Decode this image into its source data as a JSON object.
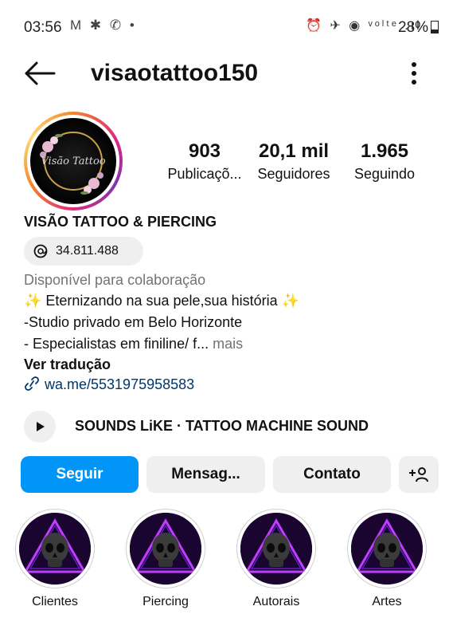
{
  "status_bar": {
    "time": "03:56",
    "left_icons": "M ✱ ✆ •",
    "right_icons": "⏰ ✈ ◉ ᵛᵒˡᵗᵉ .ıl",
    "battery": "28%"
  },
  "header": {
    "back_icon": "arrow-left-icon",
    "username": "visaotattoo150",
    "menu_icon": "kebab-menu-icon"
  },
  "profile": {
    "avatar_text": "Visão Tattoo",
    "stats": [
      {
        "value": "903",
        "label": "Publicaçõ..."
      },
      {
        "value": "20,1 mil",
        "label": "Seguidores"
      },
      {
        "value": "1.965",
        "label": "Seguindo"
      }
    ],
    "name": "VISÃO TATTOO & PIERCING",
    "threads": {
      "icon": "threads-icon",
      "count": "34.811.488"
    },
    "category": "Disponível para colaboração",
    "bio_lines": [
      "✨ Eternizando na sua pele,sua história ✨",
      "-Studio privado em Belo Horizonte",
      "- Especialistas em finiline/ f..."
    ],
    "bio_more": "mais",
    "translate": "Ver tradução",
    "link": {
      "icon": "link-icon",
      "text": "wa.me/5531975958583"
    },
    "music": {
      "icon": "play-icon",
      "title": "SOUNDS LiKE · TATTOO MACHINE SOUND"
    }
  },
  "actions": {
    "follow": "Seguir",
    "message": "Mensag...",
    "contact": "Contato",
    "add_user_icon": "add-person-icon",
    "primary_color": "#0095f6"
  },
  "highlights": [
    {
      "label": "Clientes"
    },
    {
      "label": "Piercing"
    },
    {
      "label": "Autorais"
    },
    {
      "label": "Artes"
    }
  ]
}
